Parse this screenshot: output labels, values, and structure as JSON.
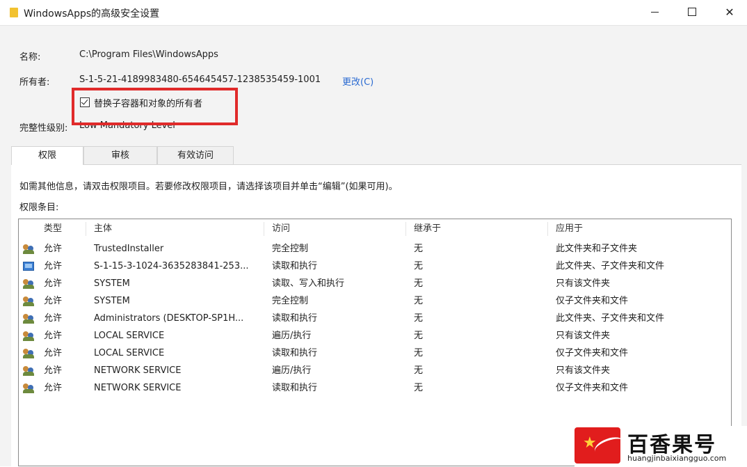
{
  "window": {
    "title": "WindowsApps的高级安全设置"
  },
  "fields": {
    "name_label": "名称:",
    "name_value": "C:\\Program Files\\WindowsApps",
    "owner_label": "所有者:",
    "owner_value": "S-1-5-21-4189983480-654645457-1238535459-1001",
    "change_link": "更改(C)",
    "replace_owner_checkbox": "替换子容器和对象的所有者",
    "replace_owner_checked": true,
    "integrity_label": "完整性级别:",
    "integrity_value": "Low Mandatory Level"
  },
  "tabs": [
    {
      "label": "权限",
      "active": true
    },
    {
      "label": "审核",
      "active": false
    },
    {
      "label": "有效访问",
      "active": false
    }
  ],
  "panel": {
    "info_text": "如需其他信息，请双击权限项目。若要修改权限项目，请选择该项目并单击“编辑”(如果可用)。",
    "entries_label": "权限条目:"
  },
  "table": {
    "columns": [
      "类型",
      "主体",
      "访问",
      "继承于",
      "应用于"
    ],
    "rows": [
      {
        "icon": "users-icon",
        "type": "允许",
        "principal": "TrustedInstaller",
        "access": "完全控制",
        "inherited": "无",
        "applies": "此文件夹和子文件夹"
      },
      {
        "icon": "app-package-icon",
        "type": "允许",
        "principal": "S-1-15-3-1024-3635283841-253...",
        "access": "读取和执行",
        "inherited": "无",
        "applies": "此文件夹、子文件夹和文件"
      },
      {
        "icon": "users-icon",
        "type": "允许",
        "principal": "SYSTEM",
        "access": "读取、写入和执行",
        "inherited": "无",
        "applies": "只有该文件夹"
      },
      {
        "icon": "users-icon",
        "type": "允许",
        "principal": "SYSTEM",
        "access": "完全控制",
        "inherited": "无",
        "applies": "仅子文件夹和文件"
      },
      {
        "icon": "users-icon",
        "type": "允许",
        "principal": "Administrators (DESKTOP-SP1H...",
        "access": "读取和执行",
        "inherited": "无",
        "applies": "此文件夹、子文件夹和文件"
      },
      {
        "icon": "users-icon",
        "type": "允许",
        "principal": "LOCAL SERVICE",
        "access": "遍历/执行",
        "inherited": "无",
        "applies": "只有该文件夹"
      },
      {
        "icon": "users-icon",
        "type": "允许",
        "principal": "LOCAL SERVICE",
        "access": "读取和执行",
        "inherited": "无",
        "applies": "仅子文件夹和文件"
      },
      {
        "icon": "users-icon",
        "type": "允许",
        "principal": "NETWORK SERVICE",
        "access": "遍历/执行",
        "inherited": "无",
        "applies": "只有该文件夹"
      },
      {
        "icon": "users-icon",
        "type": "允许",
        "principal": "NETWORK SERVICE",
        "access": "读取和执行",
        "inherited": "无",
        "applies": "仅子文件夹和文件"
      }
    ]
  },
  "watermark": {
    "name": "百香果号",
    "url": "huangjinbaixiangguo.com"
  },
  "colors": {
    "highlight_border": "#e02a2a",
    "link": "#2a6ad1",
    "watermark_red": "#e11d1d"
  }
}
